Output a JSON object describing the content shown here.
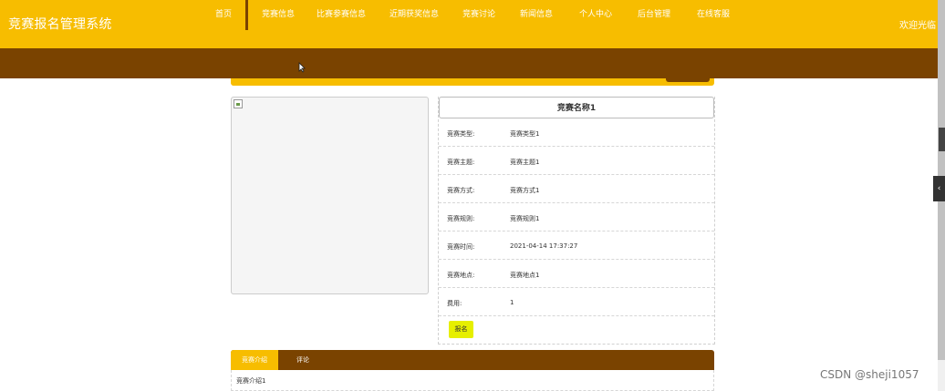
{
  "header": {
    "site_title": "竞赛报名管理系统",
    "welcome_text": "欢迎光临"
  },
  "nav": {
    "items": [
      {
        "label": "首页"
      },
      {
        "label": "竞赛信息"
      },
      {
        "label": "比赛参赛信息"
      },
      {
        "label": "近期获奖信息"
      },
      {
        "label": "竞赛讨论"
      },
      {
        "label": "新闻信息"
      },
      {
        "label": "个人中心"
      },
      {
        "label": "后台管理"
      },
      {
        "label": "在线客服"
      }
    ],
    "active_index": 1
  },
  "detail": {
    "title": "竞赛名称1",
    "fields": [
      {
        "label": "竞赛类型:",
        "value": "竞赛类型1"
      },
      {
        "label": "竞赛主题:",
        "value": "竞赛主题1"
      },
      {
        "label": "竞赛方式:",
        "value": "竞赛方式1"
      },
      {
        "label": "竞赛规则:",
        "value": "竞赛规则1"
      },
      {
        "label": "竞赛时间:",
        "value": "2021-04-14 17:37:27"
      },
      {
        "label": "竞赛地点:",
        "value": "竞赛地点1"
      },
      {
        "label": "费用:",
        "value": "1"
      }
    ],
    "signup_label": "报名"
  },
  "tabs": {
    "items": [
      {
        "label": "竞赛介绍"
      },
      {
        "label": "评论"
      }
    ],
    "content": "竞赛介绍1"
  },
  "watermark": "CSDN @sheji1057",
  "colors": {
    "primary_yellow": "#f7bd00",
    "nav_brown": "#7a4300",
    "signup_button": "#e6ef00"
  }
}
